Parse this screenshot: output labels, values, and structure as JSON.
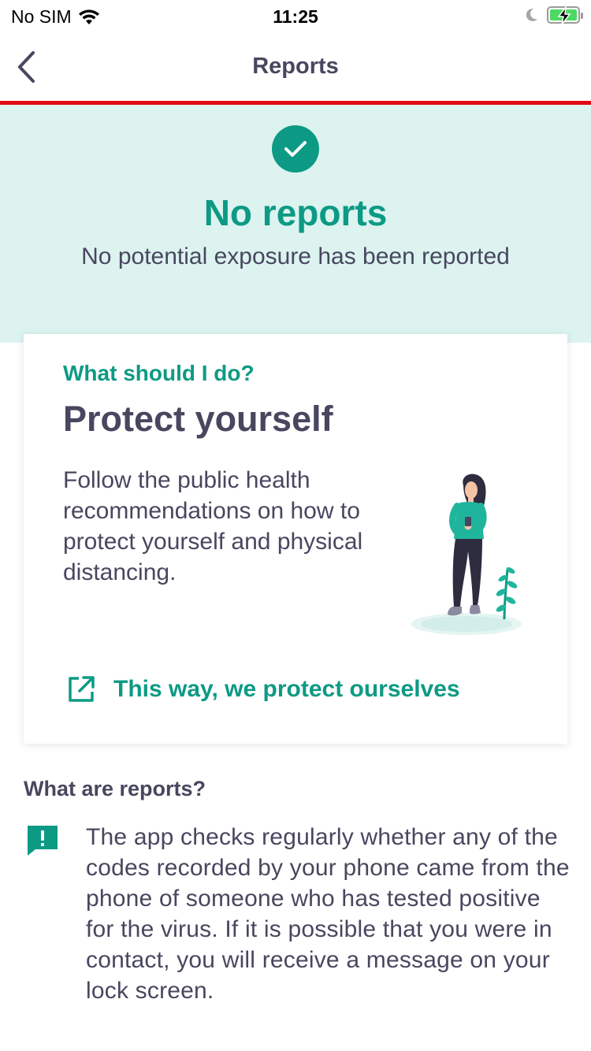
{
  "status_bar": {
    "carrier": "No SIM",
    "time": "11:25"
  },
  "nav": {
    "title": "Reports"
  },
  "hero": {
    "title": "No reports",
    "subtitle": "No potential exposure has been reported"
  },
  "card": {
    "eyebrow": "What should I do?",
    "title": "Protect yourself",
    "body": "Follow the public health recommendations on how to protect yourself and physical distancing.",
    "link_label": "This way, we protect ourselves"
  },
  "info": {
    "heading": "What are reports?",
    "text": "The app checks regularly whether any of the codes recorded by your phone came from the phone of someone who has tested positive for the virus.  If it is possible that you were in contact, you will receive a message on your lock screen."
  },
  "colors": {
    "accent": "#0d9a84",
    "hero_background": "#dcf3f0",
    "nav_divider": "#e30613",
    "text": "#48475f"
  },
  "icons": [
    "wifi-icon",
    "moon-icon",
    "battery-icon",
    "back-chevron-icon",
    "check-icon",
    "external-link-icon",
    "alert-message-icon",
    "person-illustration"
  ]
}
